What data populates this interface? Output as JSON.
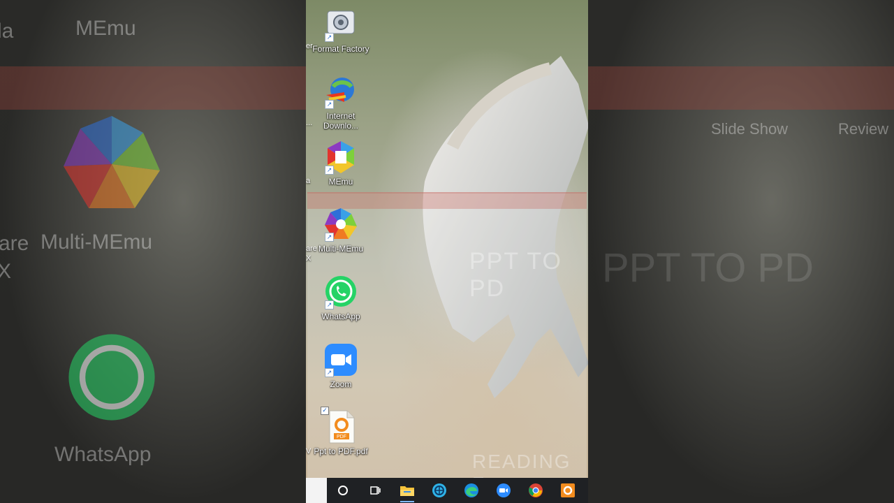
{
  "background_side_text": {
    "left_top": "MEmu",
    "left_fragment": "la",
    "left_mid": "Multi-MEmu",
    "left_mid_fragment": "are",
    "left_mid_fragment2": "X",
    "left_bottom": "WhatsApp",
    "right_ghost": "PPT TO PD",
    "right_menu_1": "Slide Show",
    "right_menu_2": "Review"
  },
  "desktop": {
    "icons": [
      {
        "label": "Format Factory",
        "icon": "format-factory-icon"
      },
      {
        "label": "Internet Downlo...",
        "icon": "internet-download-manager-icon"
      },
      {
        "label": "MEmu",
        "icon": "memu-icon"
      },
      {
        "label": "Multi-MEmu",
        "icon": "multi-memu-icon"
      },
      {
        "label": "WhatsApp",
        "icon": "whatsapp-icon"
      },
      {
        "label": "Zoom",
        "icon": "zoom-icon"
      },
      {
        "label": "Ppt to PDF.pdf",
        "icon": "pdf-file-icon"
      }
    ],
    "edge_fragments": [
      "er",
      "...",
      "a",
      "are",
      "X",
      "V"
    ],
    "overlay_text": "PPT TO PD",
    "overlay_bottom_text": "READING F"
  },
  "taskbar": {
    "items": [
      {
        "name": "cortana-search",
        "icon": "circle-icon"
      },
      {
        "name": "task-view",
        "icon": "task-view-icon"
      },
      {
        "name": "file-explorer",
        "icon": "folder-icon"
      },
      {
        "name": "app-blue",
        "icon": "app-icon"
      },
      {
        "name": "edge",
        "icon": "edge-icon"
      },
      {
        "name": "zoom",
        "icon": "zoom-icon"
      },
      {
        "name": "chrome",
        "icon": "chrome-icon"
      },
      {
        "name": "pdf-app",
        "icon": "pdf-app-icon"
      }
    ]
  },
  "colors": {
    "taskbar": "#1f2124",
    "whatsapp": "#25d366",
    "zoom": "#2d8cff",
    "pdf_orange": "#f28c1e"
  }
}
